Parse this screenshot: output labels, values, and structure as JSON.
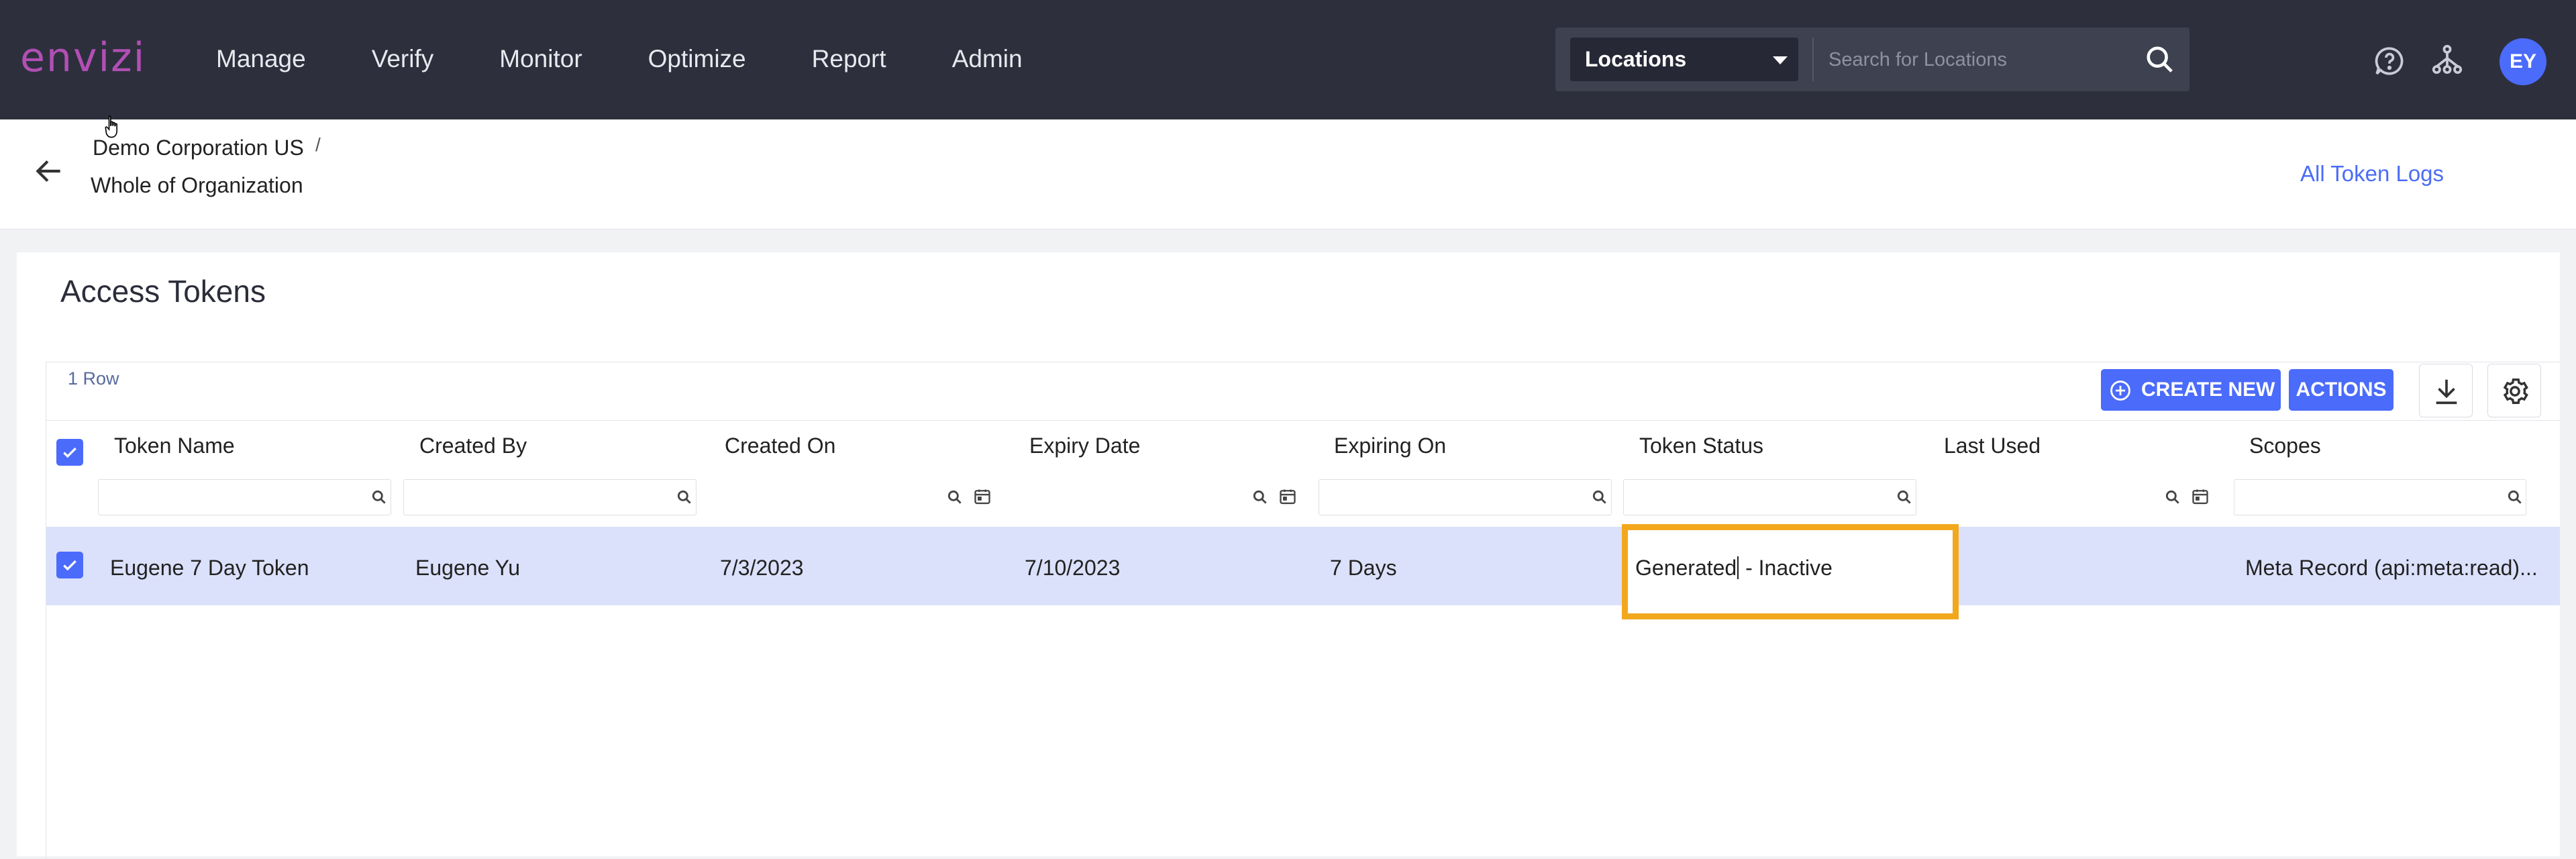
{
  "app": {
    "logo_text": "envizi",
    "nav": [
      "Manage",
      "Verify",
      "Monitor",
      "Optimize",
      "Report",
      "Admin"
    ],
    "location_select": "Locations",
    "search_placeholder": "Search for Locations",
    "avatar_initials": "EY"
  },
  "breadcrumb": {
    "org": "Demo Corporation US",
    "separator": "/",
    "scope": "Whole of Organization",
    "all_token_logs": "All Token Logs"
  },
  "page": {
    "title": "Access Tokens",
    "row_count": "1 Row",
    "create_new": "CREATE NEW",
    "actions": "ACTIONS"
  },
  "table": {
    "columns": [
      "Token Name",
      "Created By",
      "Created On",
      "Expiry Date",
      "Expiring On",
      "Token Status",
      "Last Used",
      "Scopes"
    ],
    "rows": [
      {
        "token_name": "Eugene 7 Day Token",
        "created_by": "Eugene Yu",
        "created_on": "7/3/2023",
        "expiry_date": "7/10/2023",
        "expiring_on": "7 Days",
        "token_status_part1": "Generated",
        "token_status_part2": " - Inactive",
        "last_used": "",
        "scopes": "Meta Record (api:meta:read)..."
      }
    ]
  },
  "colors": {
    "topbar": "#2d2f3d",
    "brand": "#b14fb4",
    "accent": "#4b6bfb",
    "selected_row": "#dbe1fb",
    "highlight_box": "#f2a81d"
  }
}
